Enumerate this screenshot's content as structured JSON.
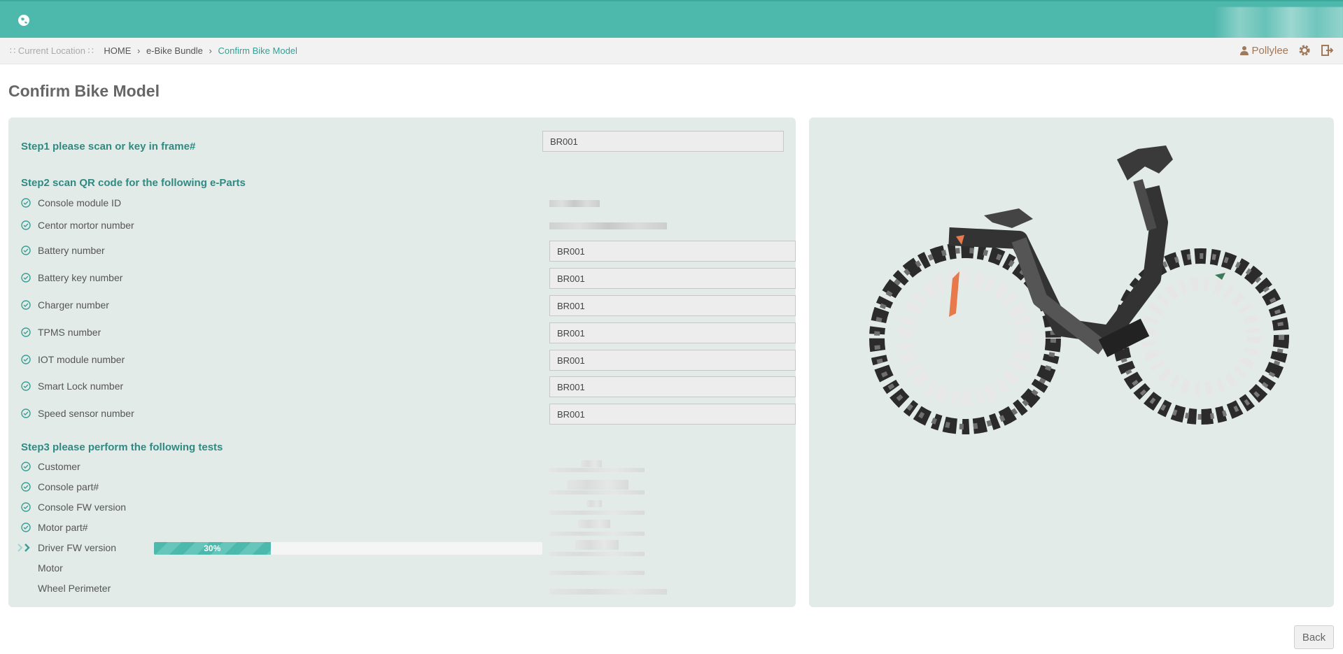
{
  "header": {
    "logo_icon": "globe-icon",
    "brand_color": "#4db8ac"
  },
  "breadcrumb": {
    "label": "Current Location",
    "items": [
      "HOME",
      "e-Bike Bundle",
      "Confirm Bike Model"
    ]
  },
  "user": {
    "name": "Pollylee",
    "icons": [
      "user-icon",
      "gear-icon",
      "logout-icon"
    ]
  },
  "page": {
    "title": "Confirm Bike Model"
  },
  "step1": {
    "title": "Step1 please scan or key in frame#",
    "frame_value": "BR001"
  },
  "step2": {
    "title": "Step2 scan QR code for the following e-Parts",
    "parts": [
      {
        "label": "Console module ID",
        "value": null
      },
      {
        "label": "Centor mortor number",
        "value": null
      },
      {
        "label": "Battery number",
        "value": "BR001"
      },
      {
        "label": "Battery key number",
        "value": "BR001"
      },
      {
        "label": "Charger number",
        "value": "BR001"
      },
      {
        "label": "TPMS number",
        "value": "BR001"
      },
      {
        "label": "IOT module number",
        "value": "BR001"
      },
      {
        "label": "Smart Lock number",
        "value": "BR001"
      },
      {
        "label": "Speed sensor number",
        "value": "BR001"
      }
    ]
  },
  "step3": {
    "title": "Step3 please perform the following tests",
    "tests": [
      {
        "label": "Customer",
        "status": "done"
      },
      {
        "label": "Console part#",
        "status": "done"
      },
      {
        "label": "Console FW version",
        "status": "done"
      },
      {
        "label": "Motor part#",
        "status": "done"
      },
      {
        "label": "Driver FW version",
        "status": "in-progress",
        "progress": 30,
        "progress_text": "30%"
      },
      {
        "label": "Motor",
        "status": "pending"
      },
      {
        "label": "Wheel Perimeter",
        "status": "pending"
      }
    ]
  },
  "actions": {
    "back_label": "Back"
  }
}
